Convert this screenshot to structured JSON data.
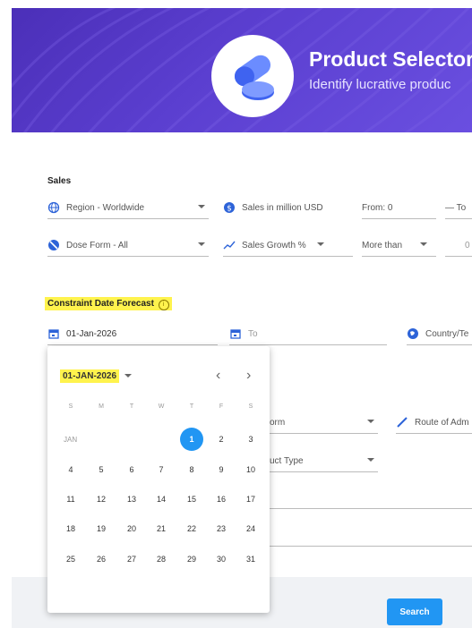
{
  "banner": {
    "title": "Product Selector",
    "subtitle": "Identify lucrative produc"
  },
  "sales": {
    "section_label": "Sales",
    "region": "Region - Worldwide",
    "sales_in_million": "Sales in million USD",
    "from": "From: 0",
    "to": "— To",
    "dose_form": "Dose Form - All",
    "sales_growth": "Sales Growth %",
    "more_than": "More than",
    "growth_value": "0"
  },
  "constraint": {
    "section_label": "Constraint Date Forecast",
    "from_date": "01-Jan-2026",
    "to_placeholder": "To",
    "country": "Country/Te"
  },
  "behind": {
    "form": "orm",
    "route": "Route of Adm",
    "product_type": "uct Type"
  },
  "calendar": {
    "header": "01-JAN-2026",
    "prev": "‹",
    "next": "›",
    "weekdays": [
      "S",
      "M",
      "T",
      "W",
      "T",
      "F",
      "S"
    ],
    "month_label": "JAN",
    "selected_day": "1",
    "days": [
      "1",
      "2",
      "3",
      "4",
      "5",
      "6",
      "7",
      "8",
      "9",
      "10",
      "11",
      "12",
      "13",
      "14",
      "15",
      "16",
      "17",
      "18",
      "19",
      "20",
      "21",
      "22",
      "23",
      "24",
      "25",
      "26",
      "27",
      "28",
      "29",
      "30",
      "31"
    ]
  },
  "actions": {
    "search": "Search"
  },
  "colors": {
    "accent": "#2196f3",
    "banner": "#5b3fd0",
    "highlight": "#fff34d"
  }
}
